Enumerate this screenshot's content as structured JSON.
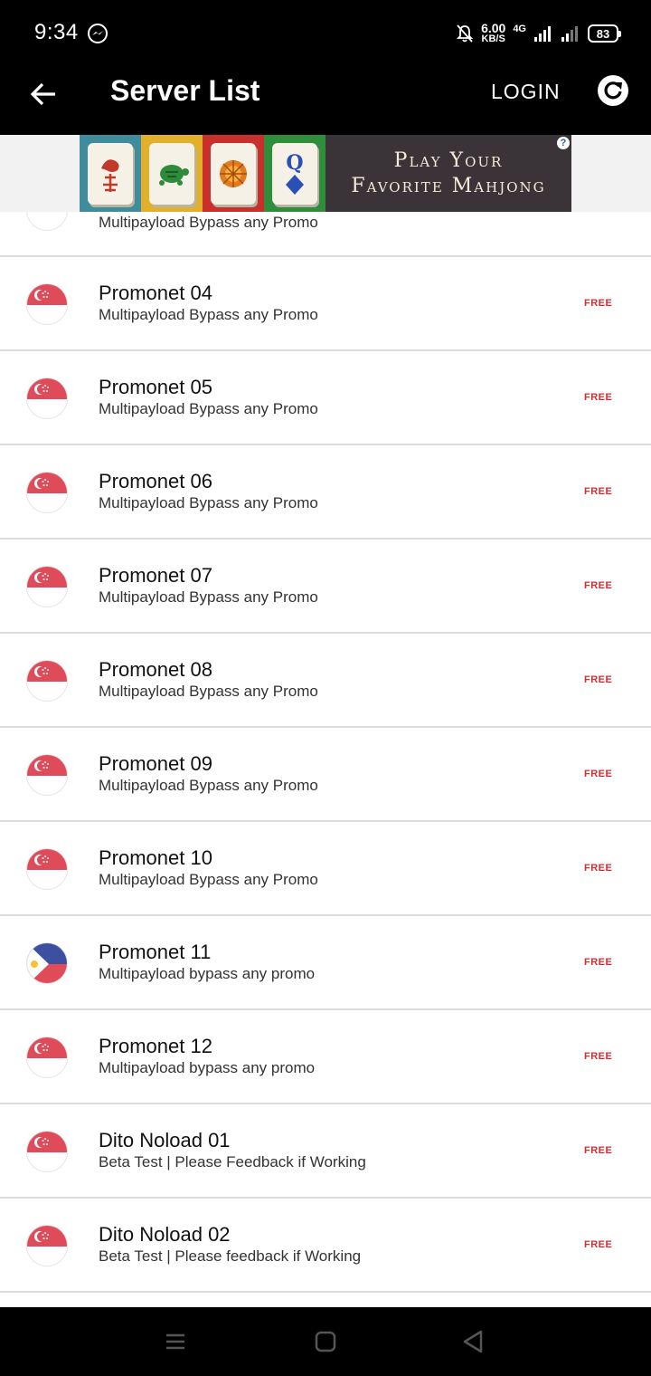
{
  "status_bar": {
    "time": "9:34",
    "speed_value": "6.00",
    "speed_unit": "KB/S",
    "network": "4G",
    "battery": "83"
  },
  "app_bar": {
    "title": "Server List",
    "login_label": "LOGIN"
  },
  "ad": {
    "line1": "Play Your",
    "line2": "Favorite Mahjong",
    "help": "?",
    "tiles": [
      "bird-tile",
      "turtle-tile",
      "flower-tile",
      "queen-tile"
    ]
  },
  "colors": {
    "accent_free": "#d32f2f",
    "bar_bg": "#000000",
    "sg_red": "#e04b5a",
    "ph_blue": "#3d4fa0"
  },
  "servers": [
    {
      "name": "",
      "desc": "Multipayload Bypass any Promo",
      "tag": "",
      "flag": "singapore-flag-icon"
    },
    {
      "name": "Promonet 04",
      "desc": "Multipayload Bypass any Promo",
      "tag": "FREE",
      "flag": "singapore-flag-icon"
    },
    {
      "name": "Promonet 05",
      "desc": "Multipayload Bypass any Promo",
      "tag": "FREE",
      "flag": "singapore-flag-icon"
    },
    {
      "name": "Promonet 06",
      "desc": "Multipayload Bypass any Promo",
      "tag": "FREE",
      "flag": "singapore-flag-icon"
    },
    {
      "name": "Promonet 07",
      "desc": "Multipayload Bypass any Promo",
      "tag": "FREE",
      "flag": "singapore-flag-icon"
    },
    {
      "name": "Promonet 08",
      "desc": "Multipayload Bypass any Promo",
      "tag": "FREE",
      "flag": "singapore-flag-icon"
    },
    {
      "name": "Promonet 09",
      "desc": "Multipayload Bypass any Promo",
      "tag": "FREE",
      "flag": "singapore-flag-icon"
    },
    {
      "name": "Promonet 10",
      "desc": "Multipayload Bypass any Promo",
      "tag": "FREE",
      "flag": "singapore-flag-icon"
    },
    {
      "name": "Promonet 11",
      "desc": "Multipayload bypass any promo",
      "tag": "FREE",
      "flag": "philippines-flag-icon"
    },
    {
      "name": "Promonet 12",
      "desc": "Multipayload bypass any promo",
      "tag": "FREE",
      "flag": "singapore-flag-icon"
    },
    {
      "name": "Dito Noload 01",
      "desc": "Beta Test | Please Feedback if Working",
      "tag": "FREE",
      "flag": "singapore-flag-icon"
    },
    {
      "name": "Dito Noload 02",
      "desc": "Beta Test | Please feedback if Working",
      "tag": "FREE",
      "flag": "singapore-flag-icon"
    }
  ],
  "nav": {
    "buttons": [
      "recents-icon",
      "home-icon",
      "back-triangle-icon"
    ]
  }
}
